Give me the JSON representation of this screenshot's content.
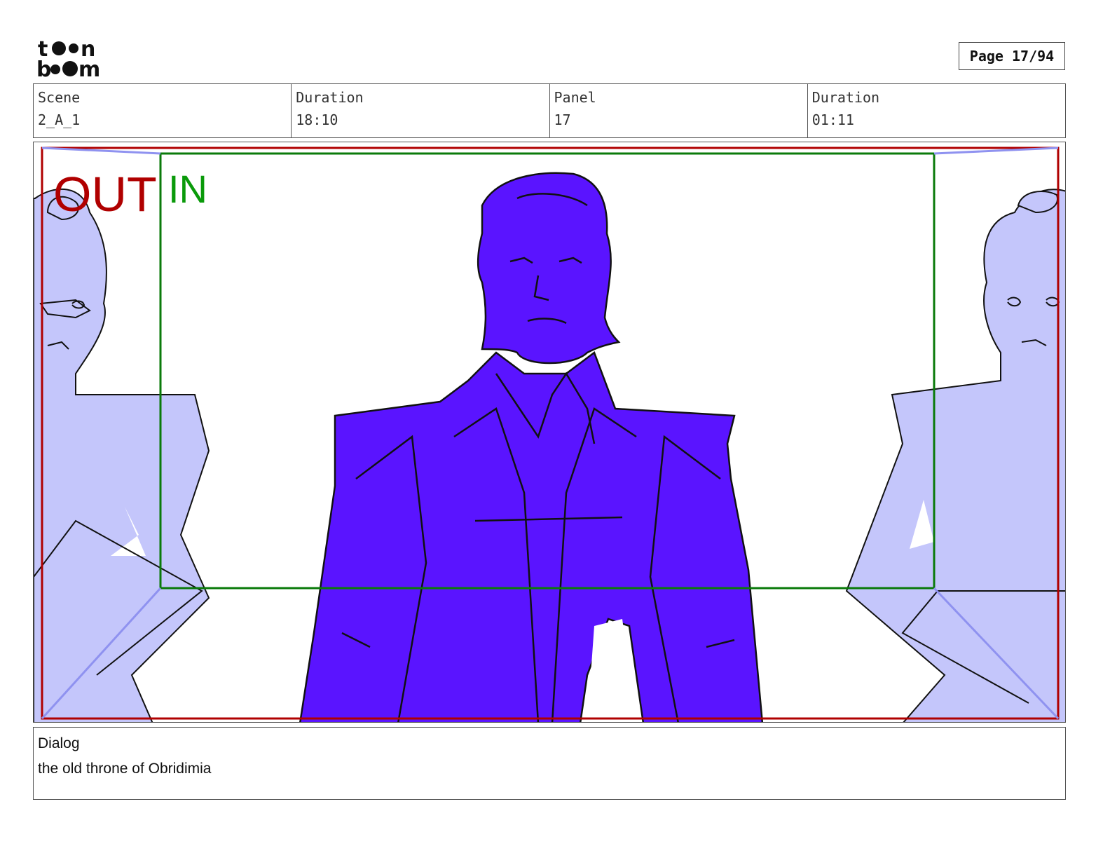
{
  "header": {
    "logo_alt": "toon boom",
    "page_label": "Page 17/94"
  },
  "info": {
    "scene_label": "Scene",
    "scene_value": "2_A_1",
    "duration_label": "Duration",
    "duration_value": "18:10",
    "panel_label": "Panel",
    "panel_value": "17",
    "panel_duration_label": "Duration",
    "panel_duration_value": "01:11"
  },
  "panel": {
    "out_label": "OUT",
    "in_label": "IN",
    "colors": {
      "out_frame": "#b00000",
      "in_frame": "#0a7a0a",
      "main_figure": "#5a14ff",
      "side_figures": "#c4c6fb"
    }
  },
  "dialog": {
    "label": "Dialog",
    "text": "the old throne of Obridimia"
  }
}
